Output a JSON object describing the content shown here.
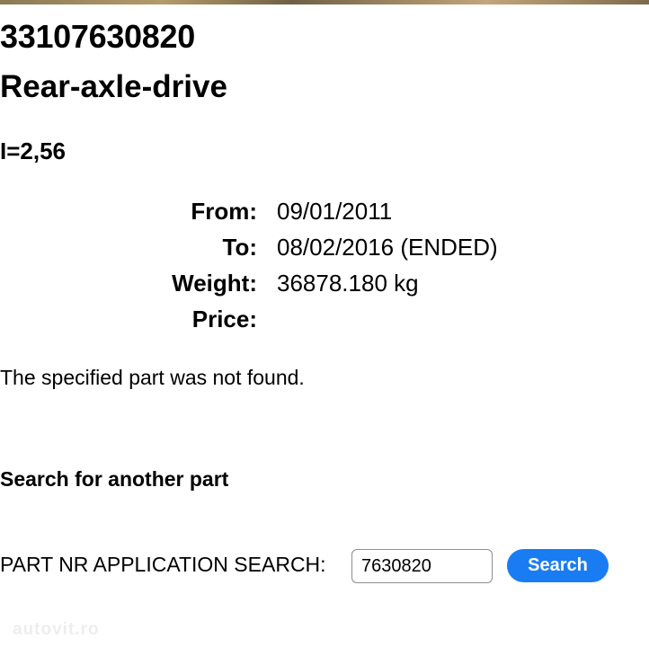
{
  "part": {
    "number": "33107630820",
    "name": "Rear-axle-drive",
    "ratio": "I=2,56"
  },
  "details": [
    {
      "label": "From:",
      "value": "09/01/2011"
    },
    {
      "label": "To:",
      "value": "08/02/2016 (ENDED)"
    },
    {
      "label": "Weight:",
      "value": "36878.180 kg"
    },
    {
      "label": "Price:",
      "value": ""
    }
  ],
  "message": "The specified part was not found.",
  "search": {
    "heading": "Search for another part",
    "label": "PART NR APPLICATION SEARCH:",
    "input_value": "7630820",
    "button_label": "Search"
  },
  "watermark": "autovit.ro"
}
